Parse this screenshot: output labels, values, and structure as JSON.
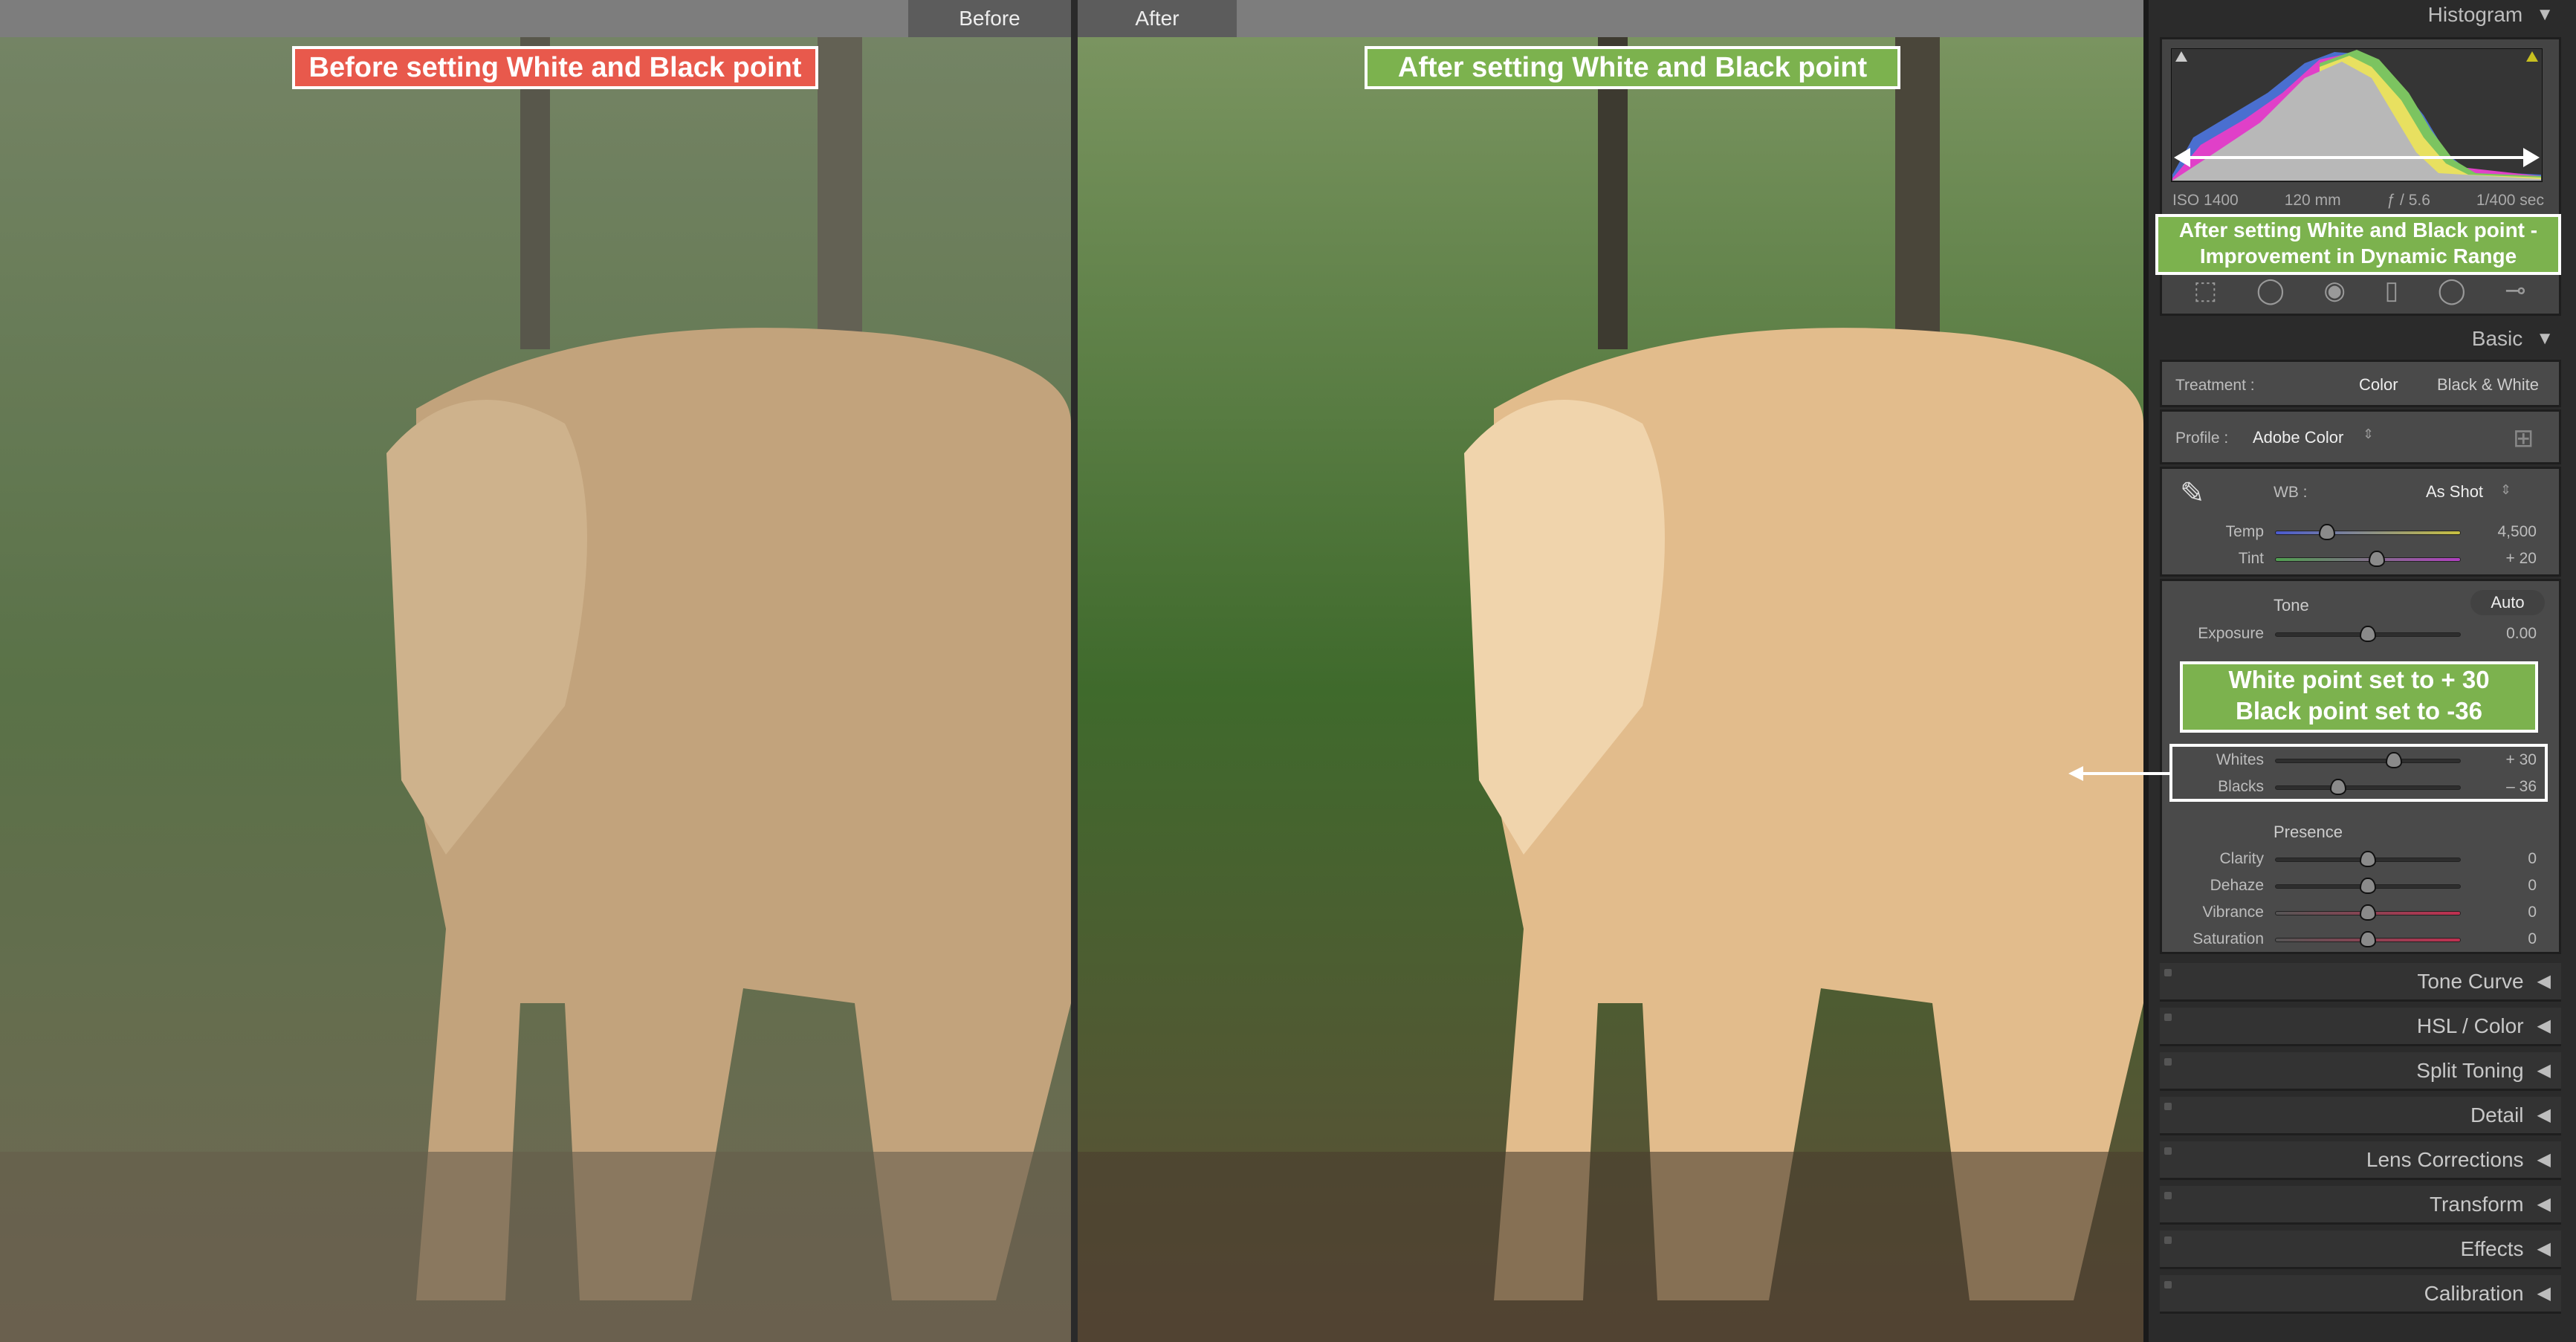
{
  "compare": {
    "before_tab": "Before",
    "after_tab": "After",
    "before_label": "Before setting White and Black point",
    "after_label": "After setting White and Black point"
  },
  "colors": {
    "before_label_bg": "#e8594c",
    "annotation_bg": "#7cb24e",
    "panel_bg": "#2b2b2b"
  },
  "histogram": {
    "title": "Histogram",
    "iso": "ISO 1400",
    "focal": "120 mm",
    "aperture": "ƒ / 5.6",
    "shutter": "1/400 sec",
    "annotation_line1": "After setting White and Black point  -",
    "annotation_line2": "Improvement in Dynamic Range"
  },
  "tools": [
    "crop-overlay-icon",
    "spot-removal-icon",
    "red-eye-icon",
    "graduated-filter-icon",
    "radial-filter-icon",
    "adjustment-brush-icon"
  ],
  "basic": {
    "title": "Basic",
    "treatment_label": "Treatment :",
    "treatment_color": "Color",
    "treatment_bw": "Black & White",
    "profile_label": "Profile :",
    "profile_value": "Adobe Color",
    "wb_label": "WB :",
    "wb_value": "As Shot",
    "tone_label": "Tone",
    "auto_label": "Auto",
    "presence_label": "Presence",
    "sliders": [
      {
        "label": "Temp",
        "value": "4,500",
        "pos": 0.28
      },
      {
        "label": "Tint",
        "value": "+ 20",
        "pos": 0.55
      },
      {
        "label": "Exposure",
        "value": "0.00",
        "pos": 0.5
      },
      {
        "label": "Whites",
        "value": "+ 30",
        "pos": 0.64
      },
      {
        "label": "Blacks",
        "value": "– 36",
        "pos": 0.34
      },
      {
        "label": "Clarity",
        "value": "0",
        "pos": 0.5
      },
      {
        "label": "Dehaze",
        "value": "0",
        "pos": 0.5
      },
      {
        "label": "Vibrance",
        "value": "0",
        "pos": 0.5
      },
      {
        "label": "Saturation",
        "value": "0",
        "pos": 0.5
      }
    ],
    "annotation_line1": "White point set to + 30",
    "annotation_line2": "Black point set to -36"
  },
  "collapsed_panels": [
    "Tone Curve",
    "HSL / Color",
    "Split Toning",
    "Detail",
    "Lens Corrections",
    "Transform",
    "Effects",
    "Calibration"
  ]
}
